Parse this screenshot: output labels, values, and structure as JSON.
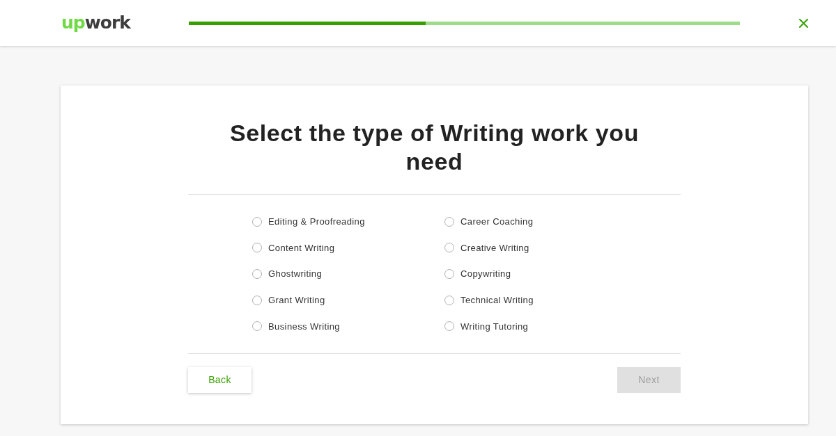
{
  "header": {
    "logo": {
      "accent": "up",
      "rest": "work"
    },
    "progress": {
      "level": 0.43
    }
  },
  "card": {
    "title": "Select the type of Writing work you need",
    "options": [
      {
        "label": "Editing & Proofreading",
        "selected": false
      },
      {
        "label": "Content Writing",
        "selected": false
      },
      {
        "label": "Ghostwriting",
        "selected": false
      },
      {
        "label": "Grant Writing",
        "selected": false
      },
      {
        "label": "Business Writing",
        "selected": false
      },
      {
        "label": "Career Coaching",
        "selected": false
      },
      {
        "label": "Creative Writing",
        "selected": false
      },
      {
        "label": "Copywriting",
        "selected": false
      },
      {
        "label": "Technical Writing",
        "selected": false
      },
      {
        "label": "Writing Tutoring",
        "selected": false
      }
    ],
    "buttons": [
      {
        "label": "Back",
        "kind": "secondary",
        "disabled": false
      },
      {
        "label": "Next",
        "kind": "primary",
        "disabled": true
      }
    ]
  }
}
